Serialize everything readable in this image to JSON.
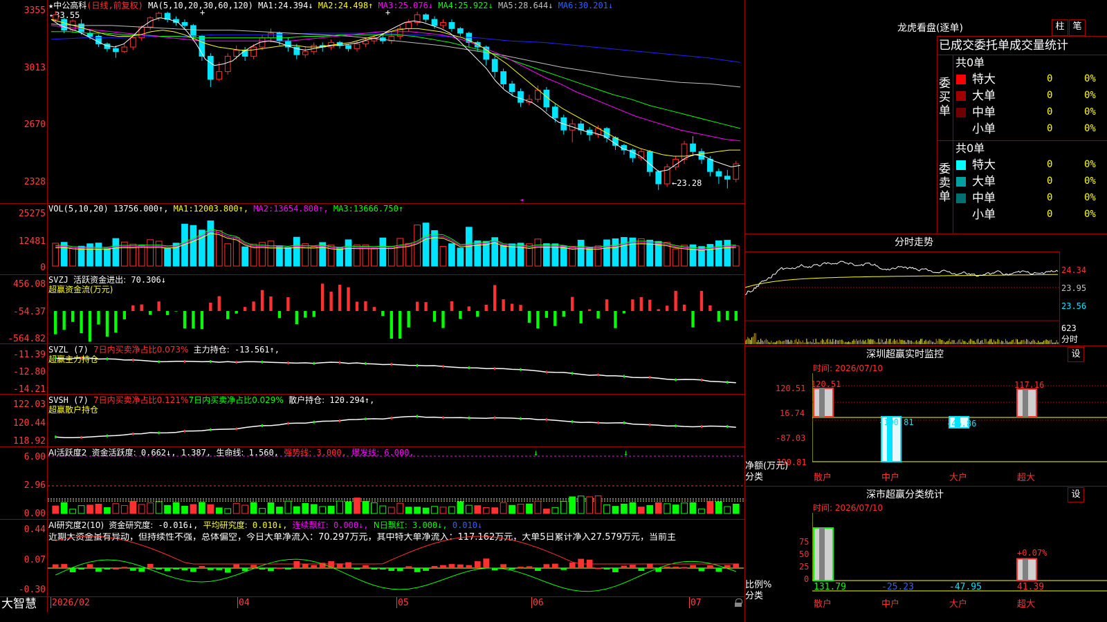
{
  "colors": {
    "up": "#ff3030",
    "down": "#00e5ff",
    "ma1": "#ffffff",
    "ma2": "#ffff00",
    "ma3": "#ff00ff",
    "ma4": "#00ff00",
    "ma5": "#c0c0c0",
    "ma6": "#2020ff",
    "frame": "#a00000",
    "axis": "#ff4040",
    "green": "#00ff00",
    "yellow": "#ffff00"
  },
  "kline": {
    "title": "★中公高科",
    "mode": "(日线,前复权)",
    "params": "MA(5,10,20,30,60,120)",
    "ma": [
      {
        "name": "MA1:",
        "value": "24.394↓"
      },
      {
        "name": "MA2:",
        "value": "24.498↑"
      },
      {
        "name": "MA3:",
        "value": "25.076↓"
      },
      {
        "name": "MA4:",
        "value": "25.922↓"
      },
      {
        "name": "MA5:",
        "value": "28.644↓"
      },
      {
        "name": "MA6:",
        "value": "30.201↓"
      }
    ],
    "y_ticks": [
      "3355",
      "3013",
      "2670",
      "2328"
    ],
    "high_label": "←33.55",
    "low_label": "←23.28",
    "candles": [
      [
        33.0,
        33.3,
        32.8,
        33.55
      ],
      [
        33.0,
        32.3,
        32.1,
        33.1
      ],
      [
        32.3,
        32.9,
        32.1,
        33.0
      ],
      [
        32.7,
        32.2,
        32.0,
        33.0
      ],
      [
        32.1,
        31.9,
        31.7,
        32.3
      ],
      [
        31.9,
        31.4,
        31.2,
        32.0
      ],
      [
        31.4,
        31.1,
        30.9,
        31.5
      ],
      [
        31.1,
        30.9,
        30.5,
        31.3
      ],
      [
        30.9,
        31.2,
        30.8,
        31.4
      ],
      [
        31.2,
        31.8,
        31.0,
        32.0
      ],
      [
        31.8,
        32.5,
        31.6,
        32.6
      ],
      [
        32.5,
        33.1,
        32.3,
        33.2
      ],
      [
        33.1,
        33.4,
        32.9,
        33.5
      ],
      [
        33.4,
        33.0,
        32.8,
        33.5
      ],
      [
        33.0,
        32.8,
        32.6,
        33.2
      ],
      [
        32.8,
        32.6,
        32.4,
        33.0
      ],
      [
        32.6,
        31.9,
        31.7,
        32.7
      ],
      [
        31.9,
        30.6,
        30.3,
        32.0
      ],
      [
        30.6,
        29.1,
        28.6,
        30.8
      ],
      [
        29.1,
        29.6,
        29.0,
        30.2
      ],
      [
        29.6,
        30.6,
        29.4,
        30.8
      ],
      [
        30.6,
        31.0,
        30.4,
        31.3
      ],
      [
        31.0,
        30.6,
        30.3,
        31.2
      ],
      [
        30.6,
        31.2,
        30.4,
        31.4
      ],
      [
        31.2,
        31.8,
        31.0,
        32.0
      ],
      [
        31.8,
        32.1,
        31.5,
        32.4
      ],
      [
        32.1,
        31.6,
        31.3,
        32.2
      ],
      [
        31.6,
        31.2,
        30.9,
        31.8
      ],
      [
        31.2,
        30.7,
        30.4,
        31.4
      ],
      [
        30.7,
        30.9,
        30.5,
        31.2
      ],
      [
        30.9,
        31.3,
        30.7,
        31.5
      ],
      [
        31.3,
        31.2,
        30.9,
        31.5
      ],
      [
        31.2,
        31.5,
        31.0,
        31.7
      ],
      [
        31.5,
        31.3,
        31.1,
        31.6
      ],
      [
        31.3,
        31.1,
        30.9,
        31.4
      ],
      [
        31.1,
        31.4,
        30.9,
        31.6
      ],
      [
        31.4,
        31.6,
        31.2,
        31.8
      ],
      [
        31.6,
        31.8,
        31.4,
        32.0
      ],
      [
        31.8,
        31.6,
        31.4,
        32.0
      ],
      [
        31.6,
        31.9,
        31.4,
        32.2
      ],
      [
        31.9,
        32.4,
        31.7,
        32.6
      ],
      [
        32.4,
        32.8,
        32.2,
        33.0
      ],
      [
        32.8,
        33.3,
        32.6,
        33.5
      ],
      [
        33.3,
        33.0,
        32.8,
        33.4
      ],
      [
        33.0,
        32.6,
        32.4,
        33.2
      ],
      [
        32.6,
        32.8,
        32.4,
        33.0
      ],
      [
        32.8,
        32.4,
        32.2,
        33.0
      ],
      [
        32.4,
        32.1,
        31.9,
        32.5
      ],
      [
        32.1,
        31.5,
        31.2,
        32.2
      ],
      [
        31.5,
        31.2,
        30.9,
        31.6
      ],
      [
        31.2,
        30.4,
        30.0,
        31.3
      ],
      [
        30.4,
        29.6,
        29.2,
        30.6
      ],
      [
        29.6,
        28.8,
        28.5,
        29.8
      ],
      [
        28.8,
        28.3,
        28.0,
        29.0
      ],
      [
        28.3,
        27.6,
        27.3,
        28.5
      ],
      [
        27.6,
        27.8,
        27.4,
        28.1
      ],
      [
        27.8,
        28.4,
        27.6,
        28.7
      ],
      [
        28.4,
        27.3,
        27.0,
        28.6
      ],
      [
        27.3,
        26.6,
        26.3,
        27.5
      ],
      [
        26.6,
        25.8,
        25.5,
        26.8
      ],
      [
        25.8,
        26.2,
        25.0,
        26.5
      ],
      [
        26.2,
        25.8,
        25.5,
        26.4
      ],
      [
        25.8,
        25.5,
        25.1,
        26.0
      ],
      [
        25.5,
        25.9,
        25.3,
        26.1
      ],
      [
        25.9,
        25.3,
        25.0,
        26.0
      ],
      [
        25.3,
        24.8,
        24.5,
        25.4
      ],
      [
        24.8,
        24.5,
        24.2,
        24.9
      ],
      [
        24.5,
        24.0,
        23.7,
        24.6
      ],
      [
        24.0,
        24.4,
        23.8,
        24.6
      ],
      [
        24.4,
        23.1,
        22.8,
        24.5
      ],
      [
        23.1,
        22.3,
        21.9,
        23.2
      ],
      [
        22.3,
        23.4,
        22.1,
        23.6
      ],
      [
        23.4,
        23.9,
        23.2,
        24.1
      ],
      [
        23.9,
        24.9,
        23.6,
        25.1
      ],
      [
        24.9,
        24.4,
        24.1,
        25.4
      ],
      [
        24.4,
        23.9,
        23.6,
        24.6
      ],
      [
        23.9,
        23.1,
        22.8,
        24.1
      ],
      [
        23.1,
        22.8,
        22.3,
        23.3
      ],
      [
        22.8,
        22.6,
        22.0,
        23.2
      ],
      [
        22.6,
        23.6,
        22.4,
        23.8
      ]
    ],
    "ma_lines": {
      "ma1": [
        33.0,
        32.6,
        32.4,
        32.2,
        31.9,
        31.6,
        31.3,
        31.2,
        31.4,
        31.9,
        32.5,
        32.9,
        33.1,
        33.0,
        32.8,
        32.2,
        31.4,
        30.4,
        30.0,
        30.1,
        30.3,
        30.8,
        31.2,
        31.5,
        31.6,
        31.5,
        31.3,
        31.1,
        31.0,
        31.1,
        31.2,
        31.3,
        31.3,
        31.4,
        31.5,
        31.7,
        31.8,
        32.2,
        32.5,
        32.8,
        32.9,
        32.8,
        32.6,
        32.4,
        32.1,
        31.6,
        31.0,
        30.4,
        29.8,
        29.0,
        28.4,
        28.0,
        27.8,
        27.6,
        27.2,
        26.7,
        26.3,
        26.1,
        25.9,
        25.7,
        25.6,
        25.4,
        25.0,
        24.6,
        24.4,
        24.1,
        23.6,
        23.1,
        23.2,
        23.6,
        24.0,
        24.2,
        24.1,
        23.8,
        23.6,
        23.4,
        23.5
      ],
      "ma2": [
        33.0,
        32.8,
        32.6,
        32.4,
        32.2,
        32.0,
        31.9,
        31.9,
        32.0,
        32.2,
        32.3,
        32.2,
        32.0,
        31.7,
        31.4,
        31.2,
        31.1,
        31.0,
        31.0,
        31.1,
        31.2,
        31.3,
        31.3,
        31.2,
        31.2,
        31.3,
        31.4,
        31.5,
        31.7,
        31.9,
        32.1,
        32.3,
        32.4,
        32.4,
        32.3,
        32.2,
        32.0,
        31.8,
        31.5,
        31.1,
        30.6,
        30.1,
        29.5,
        28.9,
        28.3,
        27.7,
        27.2,
        26.8,
        26.4,
        26.0,
        25.6,
        25.2,
        24.9,
        24.6,
        24.4,
        24.2,
        24.1,
        24.1,
        24.2,
        24.3,
        24.4,
        24.5,
        24.5
      ],
      "ma3": [
        32.6,
        32.5,
        32.4,
        32.3,
        32.2,
        32.1,
        32.0,
        31.9,
        31.8,
        31.7,
        31.6,
        31.6,
        31.6,
        31.6,
        31.6,
        31.6,
        31.6,
        31.7,
        31.8,
        31.9,
        32.0,
        32.1,
        32.2,
        32.2,
        32.2,
        32.1,
        32.0,
        31.8,
        31.5,
        31.1,
        30.7,
        30.2,
        29.7,
        29.2,
        28.8,
        28.3,
        27.9,
        27.5,
        27.1,
        26.7,
        26.4,
        26.1,
        25.8,
        25.6,
        25.4,
        25.2,
        25.1
      ],
      "ma4": [
        32.2,
        32.2,
        32.1,
        32.1,
        32.0,
        32.0,
        31.9,
        31.9,
        31.8,
        31.8,
        31.8,
        31.8,
        31.8,
        31.8,
        31.9,
        31.9,
        32.0,
        32.0,
        32.0,
        32.0,
        31.9,
        31.7,
        31.5,
        31.2,
        30.9,
        30.5,
        30.1,
        29.7,
        29.3,
        28.9,
        28.5,
        28.1,
        27.8,
        27.4,
        27.1,
        26.8,
        26.5,
        26.2,
        25.9
      ],
      "ma5": [
        32.7,
        32.6,
        32.6,
        32.5,
        32.4,
        32.3,
        32.3,
        32.2,
        32.1,
        32.0,
        31.9,
        31.7,
        31.5,
        31.3,
        31.0,
        30.7,
        30.3,
        29.9,
        29.6,
        29.3,
        29.1,
        28.9,
        28.8,
        28.6
      ],
      "ma6": [
        31.7,
        31.8,
        31.8,
        31.9,
        31.9,
        32.0,
        32.0,
        32.0,
        32.1,
        32.1,
        32.1,
        32.0,
        31.9,
        31.8,
        31.6,
        31.5,
        31.3,
        31.1,
        30.9,
        30.7,
        30.5,
        30.2
      ]
    }
  },
  "vol": {
    "title": "VOL(5,10,20)",
    "value": "13756.000↑",
    "ma": [
      {
        "name": "MA1:",
        "value": "12003.800↑"
      },
      {
        "name": "MA2:",
        "value": "13654.800↑"
      },
      {
        "name": "MA3:",
        "value": "13666.750↑"
      }
    ],
    "y_ticks": [
      "25275",
      "12481",
      "0"
    ]
  },
  "svzj": {
    "title": "SVZJ",
    "label": "活跃资金进出:",
    "value": "70.306↓",
    "sub": "超赢资金流(万元)",
    "y_ticks": [
      "456.08",
      "-54.37",
      "-564.82"
    ]
  },
  "svzl": {
    "title": "SVZL (7)",
    "a": "7日内买卖净占比0.073%",
    "b": "主力持仓:",
    "bv": "-13.561↑,",
    "sub": "超赢主力持仓",
    "y_ticks": [
      "-11.39",
      "-12.80",
      "-14.21"
    ]
  },
  "svsh": {
    "title": "SVSH (7)",
    "a": "7日内买卖净占比0.121%",
    "b": "7日内买卖净占比0.029%",
    "c": "散户持仓:",
    "cv": "120.294↑,",
    "sub": "超赢散户持仓",
    "y_ticks": [
      "122.03",
      "120.44",
      "118.92"
    ]
  },
  "aihy": {
    "title": "AI活跃度2",
    "a": "资金活跃度:",
    "av": "0.662↓,",
    "b": "1.387,",
    "c": "生命线:",
    "cv": "1.560,",
    "d": "强势线:",
    "dv": "3.000,",
    "e": "爆发线:",
    "ev": "6.000,",
    "y_ticks": [
      "6.00",
      "2.96",
      "0.00"
    ]
  },
  "aiyj": {
    "title": "AI研究度2(10)",
    "a": "资金研究度:",
    "av": "-0.016↓,",
    "b": "平均研究度:",
    "bv": "0.010↓,",
    "c": "连续飘红:",
    "cv": "0.000↓,",
    "d": "N日飘红:",
    "dv": "3.000↓,",
    "ev": "0.010↓",
    "text": "近期大资金虽有异动，但持续性不强，总体偏空，今日大单净流入：70.297万元，其中特大单净流入：117.162万元，大单5日累计净入27.579万元，当前主",
    "y_ticks": [
      "0.44",
      "0.07",
      "-0.30"
    ]
  },
  "xaxis": {
    "labels": [
      "2026/02",
      "04",
      "05",
      "06",
      "07"
    ]
  },
  "brand": "大智慧",
  "dragon": {
    "title": "龙虎看盘(逐单)",
    "btn1": "柱",
    "btn2": "笔",
    "subtitle": "已成交委托单成交量统计",
    "buy": {
      "side": "委买单",
      "total": "共0单",
      "rows": [
        {
          "name": "特大",
          "n": "0",
          "p": "0%",
          "color": "#ff0000"
        },
        {
          "name": "大单",
          "n": "0",
          "p": "0%",
          "color": "#a00000"
        },
        {
          "name": "中单",
          "n": "0",
          "p": "0%",
          "color": "#700000"
        },
        {
          "name": "小单",
          "n": "0",
          "p": "0%",
          "color": "#000000"
        }
      ]
    },
    "sell": {
      "side": "委卖单",
      "total": "共0单",
      "rows": [
        {
          "name": "特大",
          "n": "0",
          "p": "0%",
          "color": "#00ffff"
        },
        {
          "name": "大单",
          "n": "0",
          "p": "0%",
          "color": "#00a0a0"
        },
        {
          "name": "中单",
          "n": "0",
          "p": "0%",
          "color": "#007070"
        },
        {
          "name": "小单",
          "n": "0",
          "p": "0%",
          "color": "#000000"
        }
      ]
    }
  },
  "intraday": {
    "title": "分时走势",
    "y_labels": [
      "24.34",
      "23.95",
      "23.56"
    ],
    "vol_label": "623",
    "unit": "分时"
  },
  "monitor": {
    "title": "深圳超赢实时监控",
    "btn": "设",
    "time": "时间: 2026/07/10",
    "y_ticks": [
      "120.51",
      "16.74",
      "-87.03",
      "-190.81"
    ],
    "ylabel1": "净额(万元)",
    "ylabel2": "分类",
    "bars": [
      {
        "cat": "散户",
        "value": 120.51,
        "label": "120.51"
      },
      {
        "cat": "中户",
        "value": -190.81,
        "label": "-190.81"
      },
      {
        "cat": "大户",
        "value": -46.86,
        "label": "-46.86"
      },
      {
        "cat": "超大",
        "value": 117.16,
        "label": "117.16"
      }
    ]
  },
  "classify": {
    "title": "深市超赢分类统计",
    "btn": "设",
    "time": "时间: 2026/07/10",
    "y_ticks": [
      "75",
      "50",
      "25",
      "0"
    ],
    "ylabel1": "比例%",
    "ylabel2": "分类",
    "values": [
      {
        "cat": "散户",
        "value": "131.79",
        "bar": 100
      },
      {
        "cat": "中户",
        "value": "-25.23",
        "bar": 0
      },
      {
        "cat": "大户",
        "value": "-47.95",
        "bar": 0
      },
      {
        "cat": "超大",
        "value": "41.39",
        "bar": 41.39
      }
    ],
    "note": "+0.07%"
  }
}
